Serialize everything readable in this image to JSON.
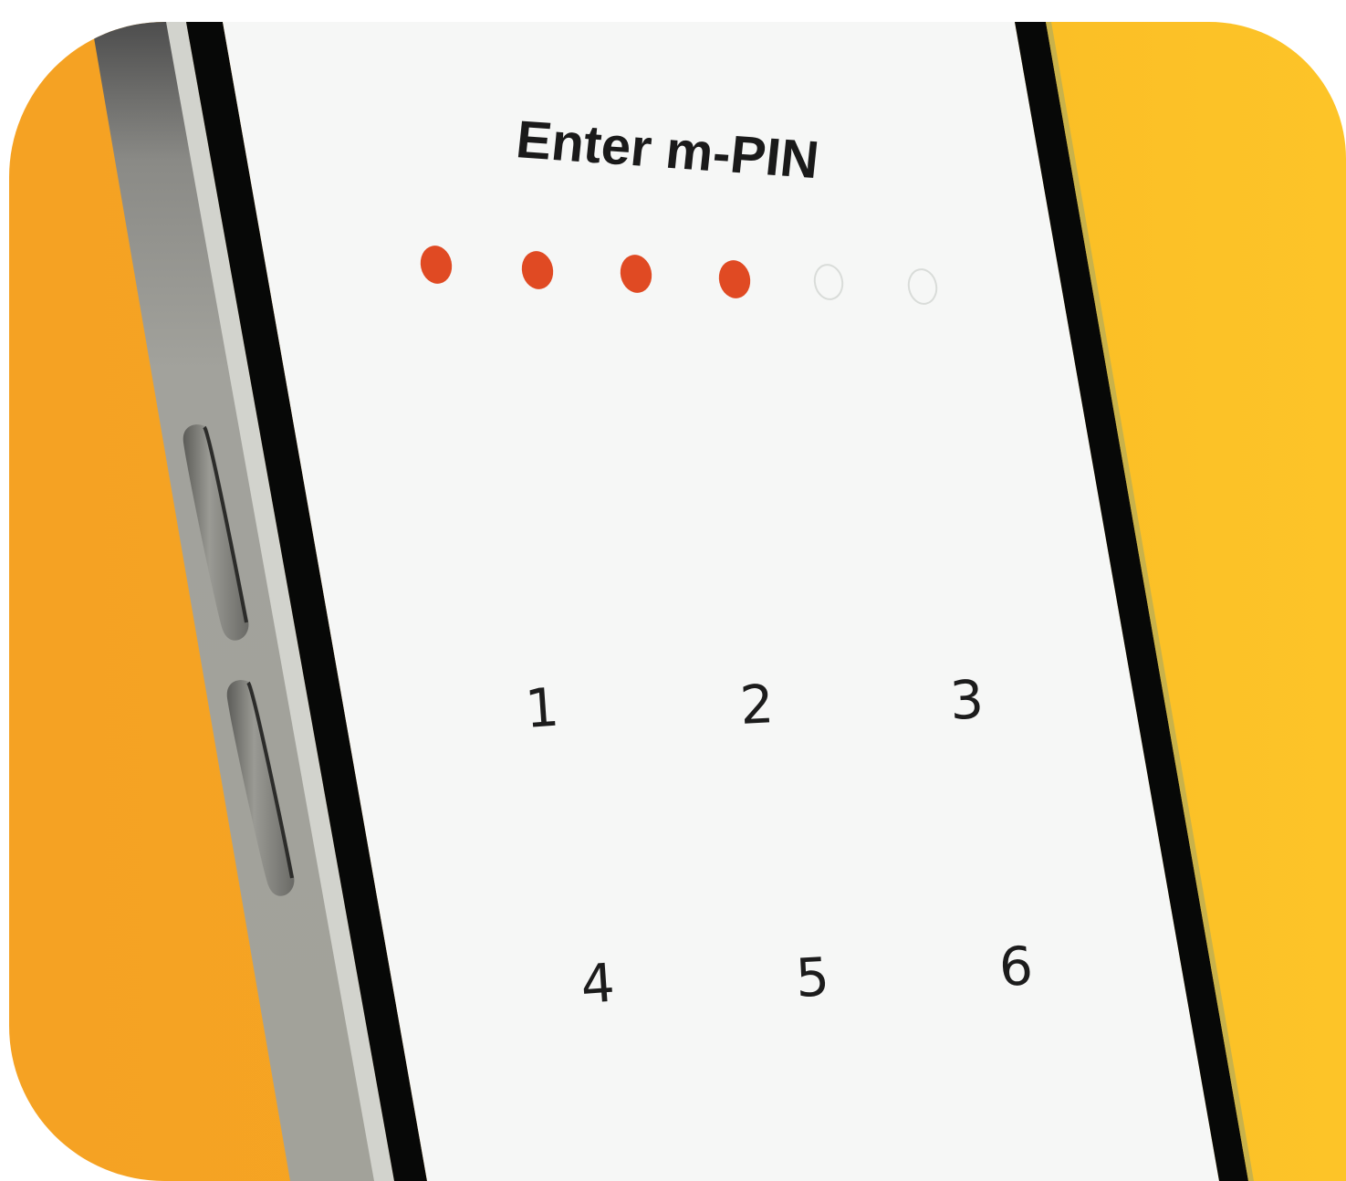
{
  "screen": {
    "title": "Enter m-PIN"
  },
  "pin": {
    "length": 6,
    "filled": 4
  },
  "keypad": {
    "keys": [
      "1",
      "2",
      "3",
      "4",
      "5",
      "6"
    ]
  },
  "colors": {
    "background_left": "#f5a223",
    "background_right": "#fdc428",
    "screen": "#f6f7f6",
    "bezel": "#070807",
    "pin_filled": "#e04a23",
    "pin_empty_stroke": "#d9dcd9"
  }
}
